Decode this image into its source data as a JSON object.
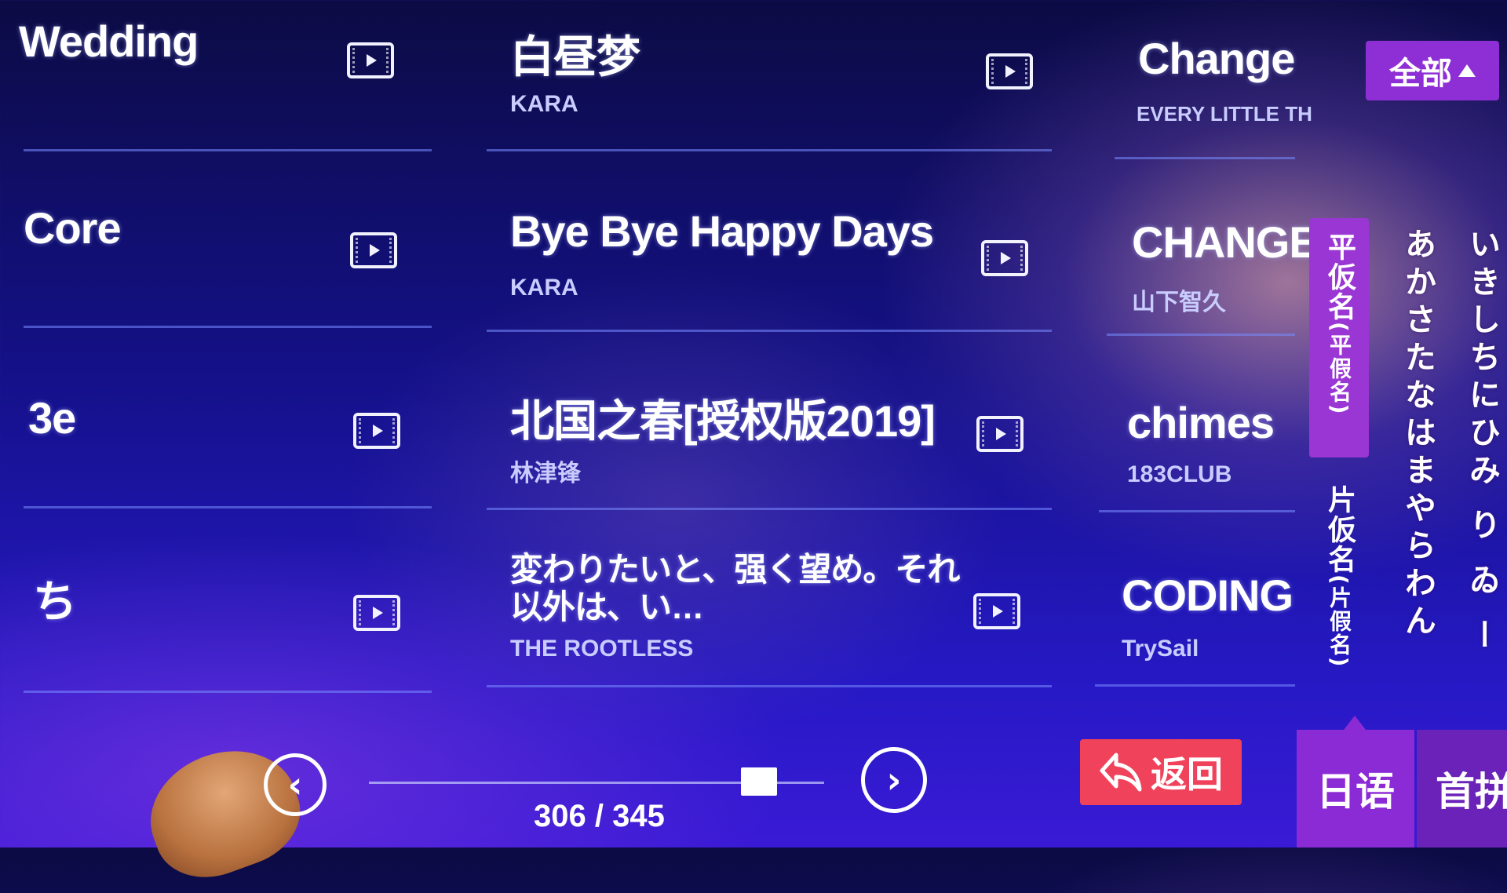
{
  "columns": [
    {
      "id": "left",
      "songs": [
        {
          "title": "Wedding",
          "artist": ""
        },
        {
          "title": "Core",
          "artist": ""
        },
        {
          "title": "3e",
          "artist": ""
        },
        {
          "title": "ち",
          "artist": ""
        }
      ]
    },
    {
      "id": "middle",
      "songs": [
        {
          "title": "白昼梦",
          "artist": "KARA"
        },
        {
          "title": "Bye Bye Happy Days",
          "artist": "KARA"
        },
        {
          "title": "北国之春[授权版2019]",
          "artist": "林津锋"
        },
        {
          "title": "変わりたいと、强く望め。それ以外は、い…",
          "artist": "THE ROOTLESS"
        }
      ]
    },
    {
      "id": "right",
      "songs": [
        {
          "title": "Change",
          "artist": "EVERY LITTLE TH"
        },
        {
          "title": "CHANGE",
          "artist": "山下智久"
        },
        {
          "title": "chimes",
          "artist": "183CLUB"
        },
        {
          "title": "CODING",
          "artist": "TrySail"
        }
      ]
    }
  ],
  "filter": {
    "all_label": "全部"
  },
  "kana_tabs": {
    "hiragana": "平仮名",
    "hiragana_paren": "(平假名)",
    "katakana": "片仮名",
    "katakana_paren": "(片假名)"
  },
  "kana_columns": [
    "あかさたなはまやらわん",
    "いきしちにひみ り ゐ ー"
  ],
  "pagination": {
    "current": 306,
    "total": 345,
    "text": "306 / 345"
  },
  "back_label": "返回",
  "bottom_tabs": {
    "japanese": "日语",
    "first_pinyin": "首拼"
  },
  "colors": {
    "accent_purple": "#8e2fd6",
    "back_red": "#f0425a",
    "background": "#14118a"
  }
}
